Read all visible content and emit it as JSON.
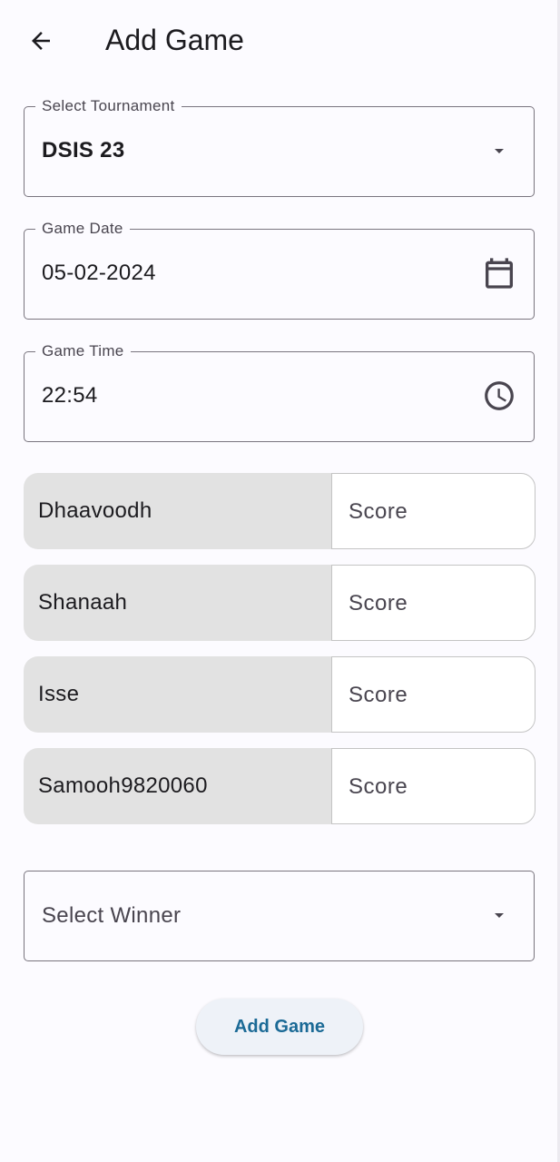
{
  "appbar": {
    "title": "Add Game",
    "back_icon": "arrow-back-icon"
  },
  "tournament": {
    "label": "Select Tournament",
    "value": "DSIS 23",
    "icon": "dropdown-arrow-icon"
  },
  "game_date": {
    "label": "Game Date",
    "value": "05-02-2024",
    "icon": "calendar-icon"
  },
  "game_time": {
    "label": "Game Time",
    "value": "22:54",
    "icon": "clock-icon"
  },
  "players": [
    {
      "name": "Dhaavoodh",
      "score_placeholder": "Score",
      "score": ""
    },
    {
      "name": "Shanaah",
      "score_placeholder": "Score",
      "score": ""
    },
    {
      "name": "Isse",
      "score_placeholder": "Score",
      "score": ""
    },
    {
      "name": "Samooh9820060",
      "score_placeholder": "Score",
      "score": ""
    }
  ],
  "winner": {
    "placeholder": "Select Winner",
    "icon": "dropdown-arrow-icon"
  },
  "submit": {
    "label": "Add Game"
  },
  "colors": {
    "background": "#fcfbff",
    "outline": "#79747e",
    "player_bg": "#e2e2e2",
    "button_text": "#1b6a96",
    "button_bg": "#eef2f8"
  }
}
